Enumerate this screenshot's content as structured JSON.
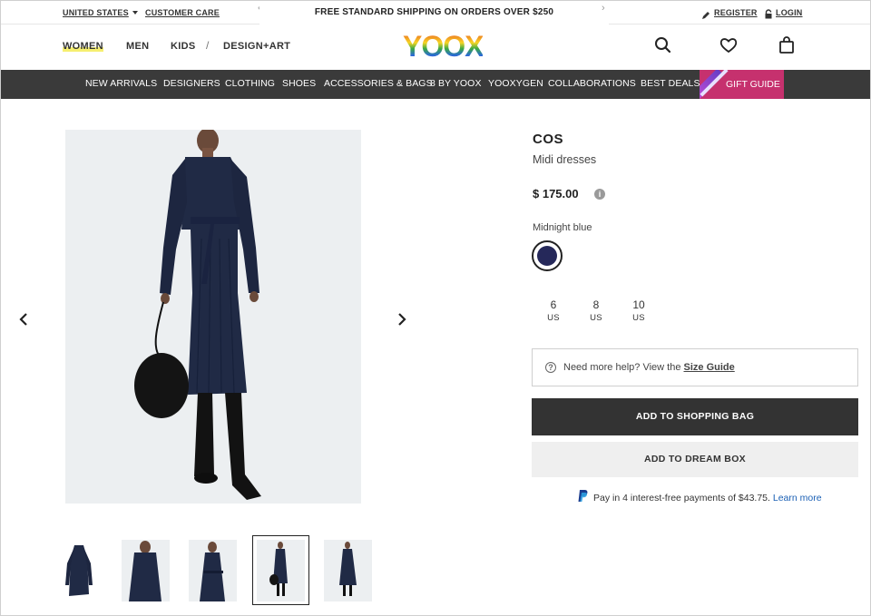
{
  "topbar": {
    "country": "UNITED STATES",
    "customer_care": "CUSTOMER CARE",
    "promo": "FREE STANDARD SHIPPING ON ORDERS OVER $250",
    "register": "REGISTER",
    "login": "LOGIN"
  },
  "header": {
    "genders": [
      "WOMEN",
      "MEN",
      "KIDS"
    ],
    "separator": "/",
    "design_art": "DESIGN+ART",
    "logo": "YOOX"
  },
  "nav": {
    "items": [
      "NEW ARRIVALS",
      "DESIGNERS",
      "CLOTHING",
      "SHOES",
      "ACCESSORIES & BAGS",
      "8 BY YOOX",
      "YOOXYGEN",
      "COLLABORATIONS",
      "BEST DEALS"
    ],
    "gift_guide": "GIFT GUIDE"
  },
  "product": {
    "brand": "COS",
    "category": "Midi dresses",
    "price": "$ 175.00",
    "color_label": "Midnight blue",
    "swatch_color": "#25285a",
    "sizes": [
      {
        "num": "6",
        "unit": "US"
      },
      {
        "num": "8",
        "unit": "US"
      },
      {
        "num": "10",
        "unit": "US"
      }
    ]
  },
  "help": {
    "text": "Need more help? View the ",
    "link": "Size Guide"
  },
  "buttons": {
    "add_to_bag": "ADD TO SHOPPING BAG",
    "add_to_dream": "ADD TO DREAM BOX"
  },
  "paypal": {
    "text": "Pay in 4 interest-free payments of $43.75.",
    "link": "Learn more"
  },
  "colors": {
    "nav_bg": "#3a3a3a",
    "gift_bg": "#c6316e",
    "dress": "#202a45",
    "paypal_link": "#1a5fb4"
  }
}
